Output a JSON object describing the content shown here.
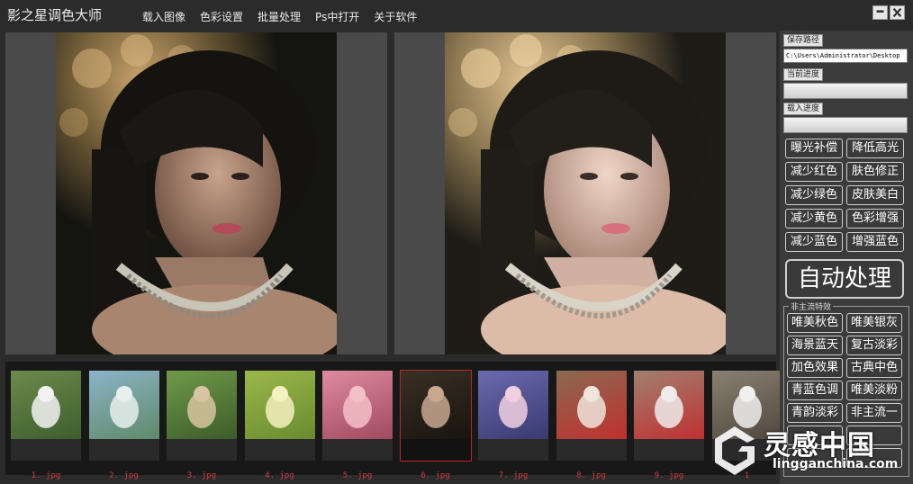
{
  "app": {
    "title": "影之星调色大师"
  },
  "menu": [
    "载入图像",
    "色彩设置",
    "批量处理",
    "Ps中打开",
    "关于软件"
  ],
  "window_controls": {
    "minimize": "minimize-icon",
    "close": "close-icon"
  },
  "panel": {
    "save_path_label": "保存路径",
    "save_path_value": "C:\\Users\\Administrator\\Desktop",
    "current_progress_label": "当前进度",
    "current_progress": 0,
    "load_progress_label": "载入进度",
    "load_progress": 0,
    "adjust_buttons": [
      [
        "曝光补偿",
        "降低高光"
      ],
      [
        "减少红色",
        "肤色修正"
      ],
      [
        "减少绿色",
        "皮肤美白"
      ],
      [
        "减少黄色",
        "色彩增强"
      ],
      [
        "减少蓝色",
        "增强蓝色"
      ]
    ],
    "auto_button": "自动处理",
    "effects_group_title": "非主流特效",
    "effect_buttons": [
      [
        "唯美秋色",
        "唯美银灰"
      ],
      [
        "海景蓝天",
        "复古淡彩"
      ],
      [
        "加色效果",
        "古典中色"
      ],
      [
        "青蓝色调",
        "唯美淡粉"
      ],
      [
        "青韵淡彩",
        "非主流一"
      ],
      [
        "",
        ""
      ],
      [
        "",
        ""
      ]
    ]
  },
  "thumbnails": [
    {
      "label": "1. jpg",
      "active": false
    },
    {
      "label": "2. jpg",
      "active": false
    },
    {
      "label": "3. jpg",
      "active": false
    },
    {
      "label": "4. jpg",
      "active": false
    },
    {
      "label": "5. jpg",
      "active": false
    },
    {
      "label": "6. jpg",
      "active": true
    },
    {
      "label": "7. jpg",
      "active": false
    },
    {
      "label": "8. jpg",
      "active": false
    },
    {
      "label": "9. jpg",
      "active": false
    },
    {
      "label": "1",
      "active": false
    }
  ],
  "watermark": {
    "text_cn": "灵感中国",
    "text_en": "lingganchina.com"
  },
  "colors": {
    "background": "#2b2b2b",
    "preview": "#4a4a4a",
    "panel": "#3b3b3b",
    "active_border": "#b52a2a",
    "thumb_label": "#d23c3c"
  }
}
